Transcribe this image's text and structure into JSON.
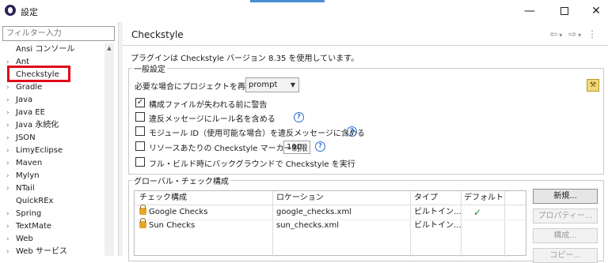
{
  "window": {
    "title": "設定",
    "minimize": "—",
    "close": "✕"
  },
  "sidebar": {
    "filter_placeholder": "フィルター入力",
    "items": [
      {
        "label": "Ansi コンソール",
        "expandable": false
      },
      {
        "label": "Ant",
        "expandable": true
      },
      {
        "label": "Checkstyle",
        "expandable": false,
        "selected": true
      },
      {
        "label": "Gradle",
        "expandable": true
      },
      {
        "label": "Java",
        "expandable": true
      },
      {
        "label": "Java EE",
        "expandable": true
      },
      {
        "label": "Java 永続化",
        "expandable": true
      },
      {
        "label": "JSON",
        "expandable": true
      },
      {
        "label": "LimyEclipse",
        "expandable": true
      },
      {
        "label": "Maven",
        "expandable": true
      },
      {
        "label": "Mylyn",
        "expandable": true
      },
      {
        "label": "NTail",
        "expandable": true
      },
      {
        "label": "QuickREx",
        "expandable": false
      },
      {
        "label": "Spring",
        "expandable": true
      },
      {
        "label": "TextMate",
        "expandable": true
      },
      {
        "label": "Web",
        "expandable": true
      },
      {
        "label": "Web サービス",
        "expandable": true
      }
    ]
  },
  "page": {
    "title": "Checkstyle",
    "version_text": "プラグインは Checkstyle バージョン 8.35 を使用しています。",
    "general": {
      "legend": "一般設定",
      "rebuild_label": "必要な場合にプロジェクトを再ビルド:",
      "rebuild_value": "prompt",
      "checkboxes": [
        {
          "label": "構成ファイルが失われる前に警告",
          "checked": true,
          "help": false
        },
        {
          "label": "違反メッセージにルール名を含める",
          "checked": false,
          "help": true
        },
        {
          "label": "モジュール ID（使用可能な場合）を違反メッセージに含める",
          "checked": false,
          "help": true
        },
        {
          "label": "リソースあたりの Checkstyle マーカー制限",
          "checked": false,
          "help": true
        },
        {
          "label": "フル・ビルド時にバックグラウンドで Checkstyle を実行",
          "checked": false,
          "help": false
        }
      ],
      "marker_limit": "100"
    },
    "global": {
      "legend": "グローバル・チェック構成",
      "columns": [
        "チェック構成",
        "ロケーション",
        "タイプ",
        "デフォルト"
      ],
      "rows": [
        {
          "name": "Google Checks",
          "location": "google_checks.xml",
          "type": "ビルトイン...",
          "default": "✓"
        },
        {
          "name": "Sun Checks",
          "location": "sun_checks.xml",
          "type": "ビルトイン...",
          "default": ""
        }
      ],
      "buttons": {
        "new": "新規...",
        "properties": "プロパティー...",
        "configure": "構成...",
        "copy": "コピー..."
      }
    }
  },
  "colors": {
    "highlight": "#e0081a",
    "accent": "#4a8bd6",
    "check": "#1e8a2c"
  }
}
